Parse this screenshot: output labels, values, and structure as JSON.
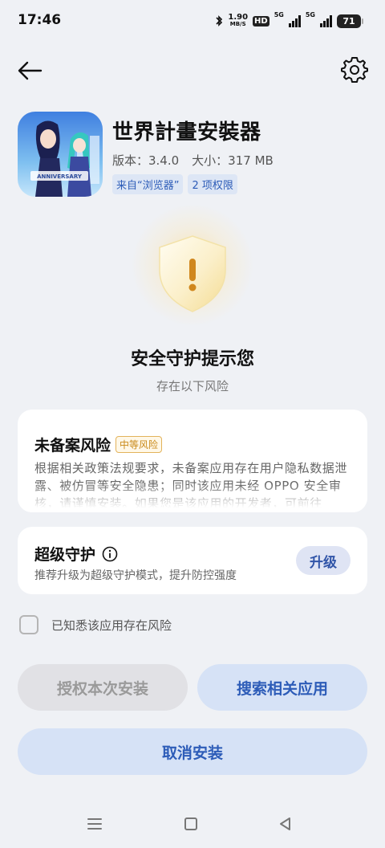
{
  "status_bar": {
    "time": "17:46",
    "speed_value": "1.90",
    "speed_unit": "MB/S",
    "hd_label": "HD",
    "network_1": "5G",
    "network_2": "5G",
    "battery": "71"
  },
  "app": {
    "name": "世界計畫安裝器",
    "version": "版本：3.4.0",
    "size": "大小：317 MB",
    "source_tag": "来自“浏览器”",
    "permission_tag": "2 项权限"
  },
  "warning": {
    "headline": "安全守护提示您",
    "subhead": "存在以下风险"
  },
  "risk_card": {
    "title": "未备案风险",
    "badge": "中等风险",
    "description": "根据相关政策法规要求，未备案应用存在用户隐私数据泄露、被仿冒等安全隐患；同时该应用未经 OPPO 安全审核，请谨慎安装。如果您是该应用的开发者，可前往"
  },
  "guard_card": {
    "title": "超级守护",
    "description": "推荐升级为超级守护模式，提升防控强度",
    "upgrade_label": "升级"
  },
  "acknowledge": {
    "label": "已知悉该应用存在风险",
    "checked": false
  },
  "buttons": {
    "authorize": "授权本次安装",
    "search": "搜索相关应用",
    "cancel": "取消安装"
  },
  "colors": {
    "accent": "#2d5cb8",
    "button_bg": "#d6e2f6",
    "disabled_bg": "#e1e1e5",
    "warning": "#e3b35b",
    "background": "#eff1f5"
  },
  "icons": {
    "back": "back-arrow-icon",
    "settings": "gear-icon",
    "info": "info-icon",
    "shield": "warning-shield-icon"
  }
}
